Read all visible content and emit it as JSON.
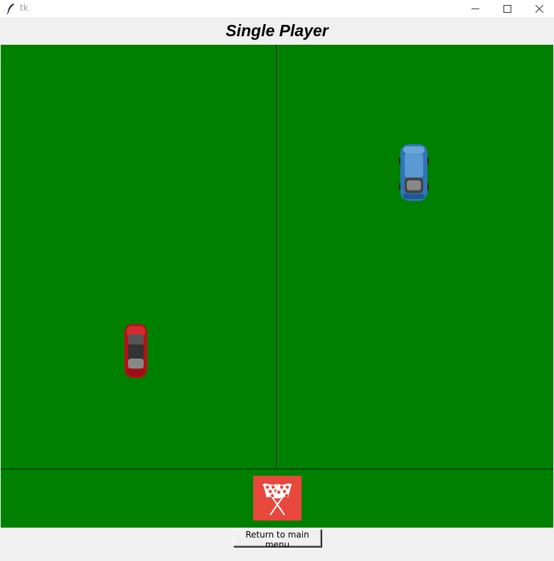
{
  "window": {
    "title": "tk",
    "icon": "feather-icon",
    "controls": [
      "minimize-icon",
      "maximize-icon",
      "close-icon"
    ]
  },
  "header": {
    "title": "Single Player"
  },
  "track": {
    "background": "#008000",
    "players": [
      {
        "car": "red-car",
        "color": "#c0121a"
      },
      {
        "car": "blue-car",
        "color": "#3b86c8"
      }
    ],
    "finish_icon": "checkered-flags-icon",
    "finish_color": "#e8473c"
  },
  "footer": {
    "return_label": "Return to main menu"
  }
}
